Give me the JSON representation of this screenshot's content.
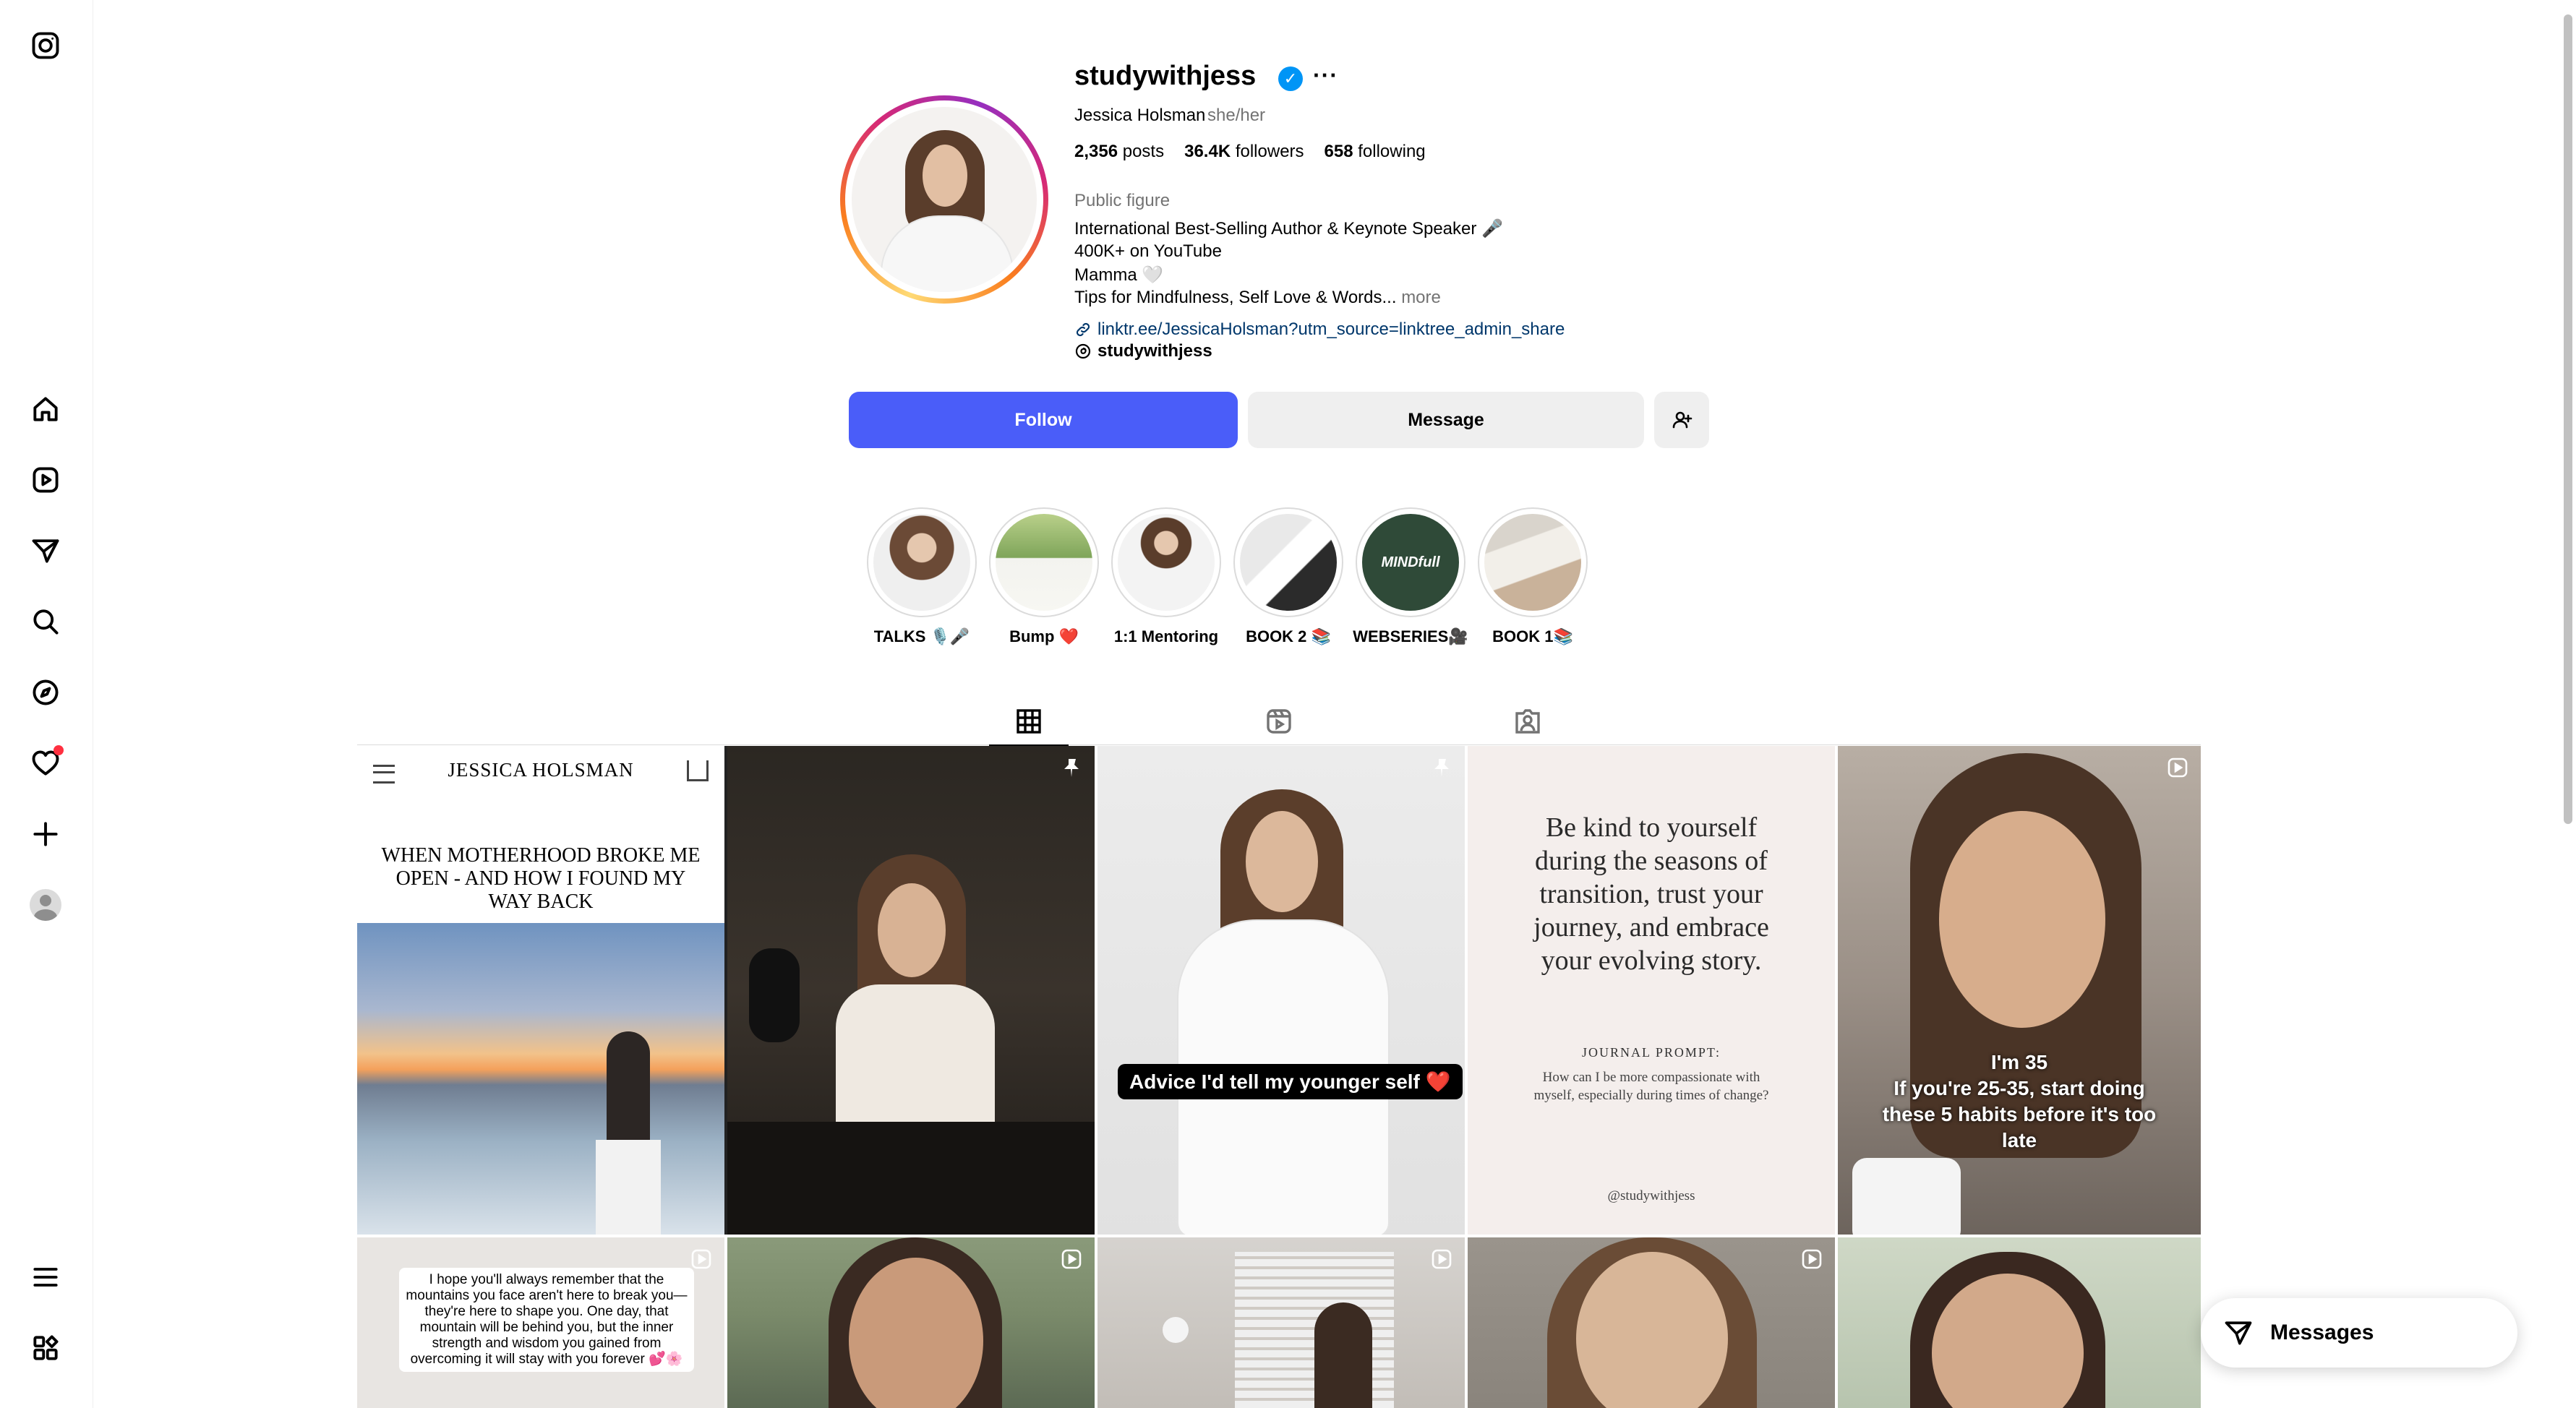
{
  "nav": {
    "items": [
      {
        "name": "instagram-logo-icon"
      },
      {
        "name": "home-icon"
      },
      {
        "name": "reels-icon"
      },
      {
        "name": "messages-icon"
      },
      {
        "name": "search-icon"
      },
      {
        "name": "explore-icon"
      },
      {
        "name": "notifications-icon"
      },
      {
        "name": "create-icon"
      },
      {
        "name": "profile-icon"
      },
      {
        "name": "more-menu-icon"
      },
      {
        "name": "also-from-meta-icon"
      }
    ]
  },
  "profile": {
    "username": "studywithjess",
    "verified_glyph": "✓",
    "options_glyph": "···",
    "full_name": "Jessica Holsman",
    "pronouns": "she/her",
    "posts_count": "2,356",
    "posts_label": "posts",
    "followers_count": "36.4K",
    "followers_label": "followers",
    "following_count": "658",
    "following_label": "following",
    "category": "Public figure",
    "bio": [
      "International Best-Selling Author & Keynote Speaker 🎤",
      "400K+ on YouTube",
      "Mamma 🤍",
      "Tips for Mindfulness, Self Love & Words..."
    ],
    "bio_more": "more",
    "link": "linktr.ee/JessicaHolsman?utm_source=linktree_admin_share",
    "threads_handle": "studywithjess"
  },
  "actions": {
    "follow_label": "Follow",
    "message_label": "Message"
  },
  "highlights": [
    {
      "label": "TALKS 🎙️🎤"
    },
    {
      "label": "Bump ❤️"
    },
    {
      "label": "1:1 Mentoring"
    },
    {
      "label": "BOOK 2 📚"
    },
    {
      "label": "WEBSERIES🎥"
    },
    {
      "label": "BOOK 1📚"
    }
  ],
  "highlight_texts": {
    "webseries_mark": "MINDfull"
  },
  "tabs": [
    "posts",
    "reels",
    "tagged"
  ],
  "posts": {
    "p1": {
      "site_name": "JESSICA HOLSMAN",
      "headline": "WHEN MOTHERHOOD BROKE ME OPEN - AND HOW I FOUND MY WAY BACK"
    },
    "p3": {
      "caption": "Advice I'd tell my younger self ❤️"
    },
    "p4": {
      "quote": "Be kind to yourself during the seasons of transition, trust your journey, and embrace your evolving story.",
      "prompt_title": "JOURNAL PROMPT:",
      "prompt": "How can I be more compassionate with myself, especially during times of change?",
      "handle": "@studywithjess"
    },
    "p5": {
      "line1": "I'm 35",
      "line2": "If you're 25-35, start doing these 5 habits before it's too late"
    },
    "p6": {
      "text": "I hope you'll always remember that the mountains you face aren't here to break you—they're here to shape you. One day, that mountain will be behind you, but the inner strength and wisdom you gained from overcoming it will stay with you forever 💕🌸"
    }
  },
  "messages_pill": {
    "label": "Messages"
  },
  "colors": {
    "follow_blue": "#4a5df9",
    "verified_blue": "#0095f6",
    "link_blue": "#00376b",
    "notification_red": "#ff3040"
  }
}
